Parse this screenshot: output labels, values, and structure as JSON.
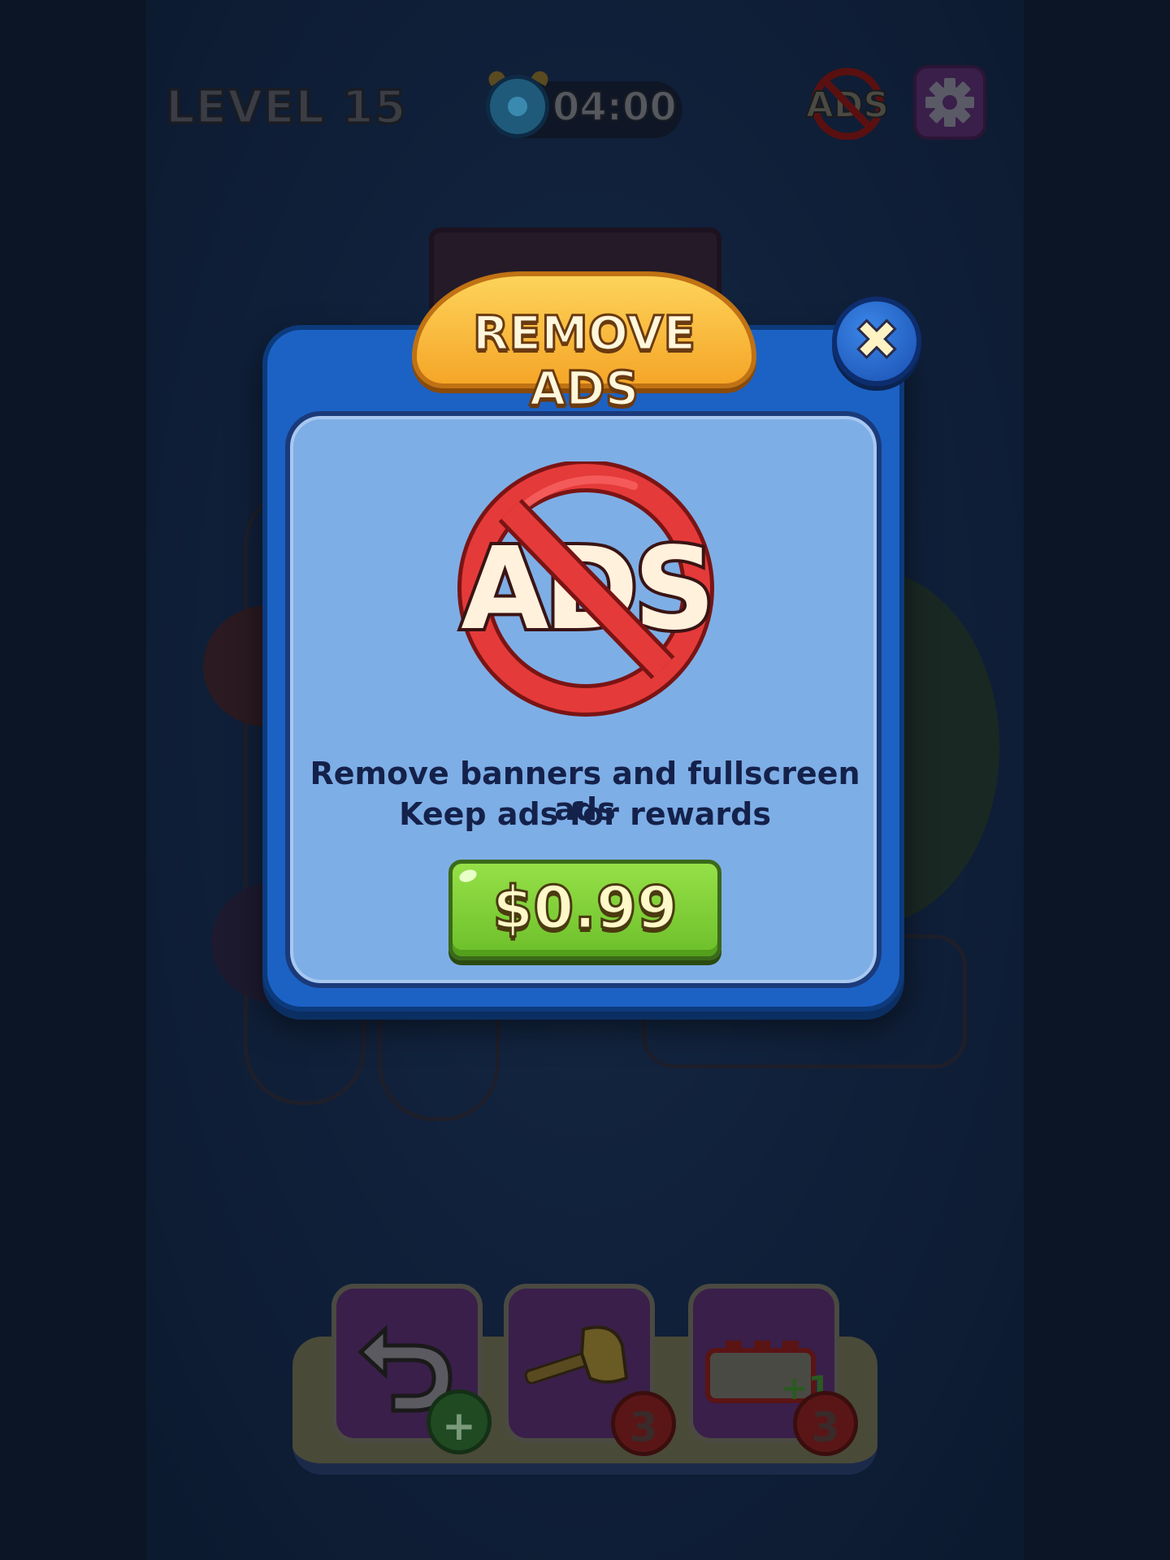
{
  "hud": {
    "level_label": "LEVEL 15",
    "timer": "04:00",
    "no_ads_icon": "no-ads-icon",
    "settings_icon": "gear-icon"
  },
  "modal": {
    "title": "REMOVE ADS",
    "close_icon": "close-icon",
    "close_glyph": "✖",
    "image_icon": "no-ads-icon",
    "description_line1": "Remove banners and fullscreen ads",
    "description_line2": "Keep ads for rewards",
    "price_label": "$0.99"
  },
  "boosters": [
    {
      "icon": "undo-icon",
      "badge_icon": "plus-icon"
    },
    {
      "icon": "hammer-icon",
      "count": "3"
    },
    {
      "icon": "extra-tube-icon",
      "count": "3",
      "icon_label": "+1"
    }
  ],
  "colors": {
    "modal_blue": "#1c62c4",
    "panel_light_blue": "#7eaee6",
    "banner_orange": "#f5a628",
    "price_green": "#78c832",
    "text_navy": "#14214a"
  }
}
